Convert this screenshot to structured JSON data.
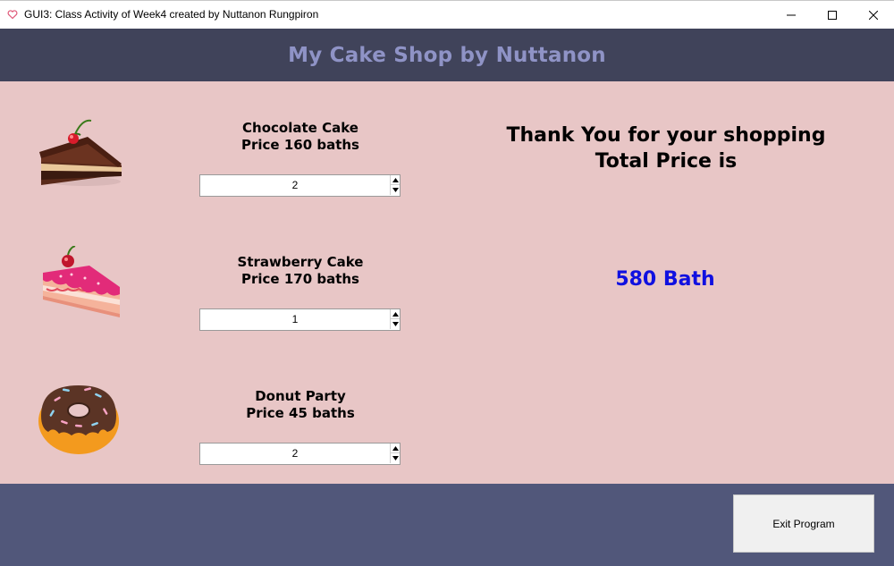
{
  "window": {
    "title": "GUI3: Class Activity of Week4 created by Nuttanon Rungpiron"
  },
  "header": {
    "title": "My Cake Shop by Nuttanon"
  },
  "products": [
    {
      "name": "Chocolate Cake",
      "price": "Price 160 baths",
      "quantity": "2",
      "icon": "chocolate-cake-icon"
    },
    {
      "name": "Strawberry Cake",
      "price": "Price 170 baths",
      "quantity": "1",
      "icon": "strawberry-cake-icon"
    },
    {
      "name": "Donut Party",
      "price": "Price 45 baths",
      "quantity": "2",
      "icon": "donut-icon"
    }
  ],
  "summary": {
    "thanks": "Thank You for your shopping",
    "total_label": "Total Price is",
    "total_value": "580 Bath"
  },
  "footer": {
    "exit_label": "Exit Program"
  },
  "colors": {
    "header_bg": "#40435a",
    "header_text": "#8f93c6",
    "main_bg": "#e8c6c6",
    "footer_bg": "#51577a",
    "total_text": "#1010e0"
  }
}
